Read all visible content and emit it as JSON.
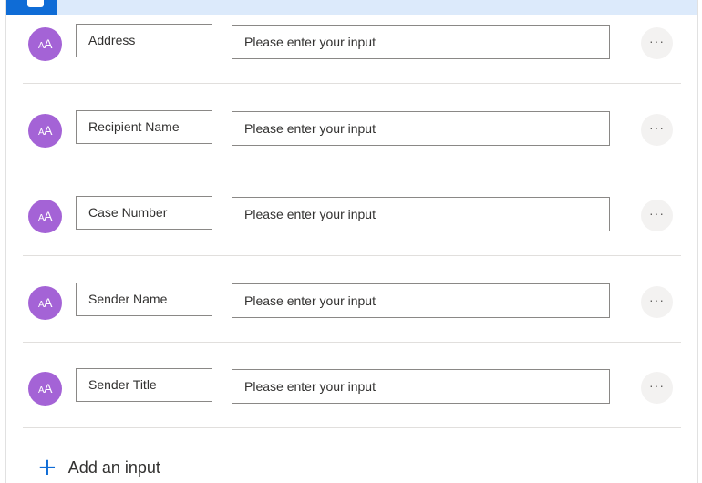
{
  "colors": {
    "header_bg": "#dceafb",
    "accent": "#0f6cd6",
    "avatar": "#a463d6",
    "border": "#8a8886",
    "divider": "#e1dfdd"
  },
  "inputs": [
    {
      "name": "Address",
      "value_placeholder": "Please enter your input",
      "avatar_text": "AA",
      "icon": "text-type-icon",
      "more_label": "···"
    },
    {
      "name": "Recipient Name",
      "value_placeholder": "Please enter your input",
      "avatar_text": "AA",
      "icon": "text-type-icon",
      "more_label": "···"
    },
    {
      "name": "Case Number",
      "value_placeholder": "Please enter your input",
      "avatar_text": "AA",
      "icon": "text-type-icon",
      "more_label": "···"
    },
    {
      "name": "Sender Name",
      "value_placeholder": "Please enter your input",
      "avatar_text": "AA",
      "icon": "text-type-icon",
      "more_label": "···"
    },
    {
      "name": "Sender Title",
      "value_placeholder": "Please enter your input",
      "avatar_text": "AA",
      "icon": "text-type-icon",
      "more_label": "···"
    }
  ],
  "add_input": {
    "label": "Add an input",
    "icon": "plus-icon",
    "icon_glyph": "+"
  }
}
